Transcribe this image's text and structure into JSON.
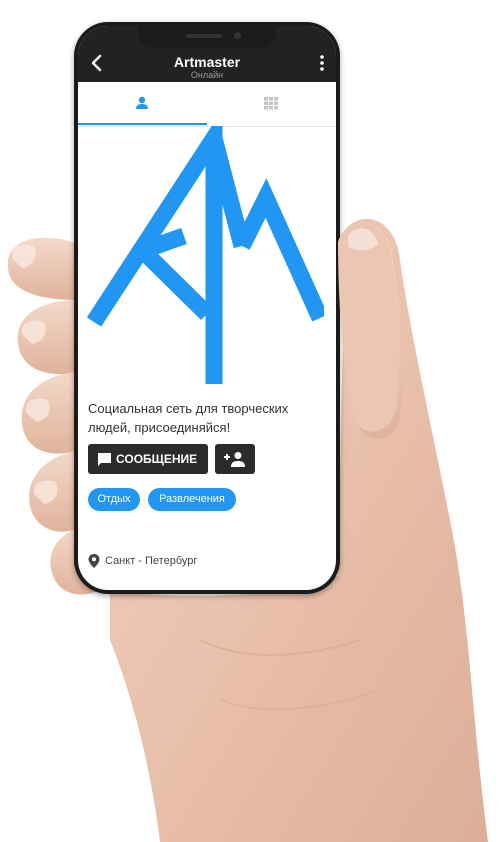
{
  "app": {
    "title": "Artmaster",
    "status": "Онлайн"
  },
  "tabs": [
    {
      "icon": "person-icon",
      "active": true
    },
    {
      "icon": "grid-icon",
      "active": false
    }
  ],
  "profile": {
    "description": "Социальная сеть для творческих людей, присоединяйся!",
    "message_button": "СООБЩЕНИЕ",
    "tags": [
      "Отдых",
      "Развлечения"
    ],
    "location": "Санкт - Петербург"
  },
  "colors": {
    "accent": "#2196f3",
    "appbar": "#222222",
    "button": "#2b2b2b"
  }
}
